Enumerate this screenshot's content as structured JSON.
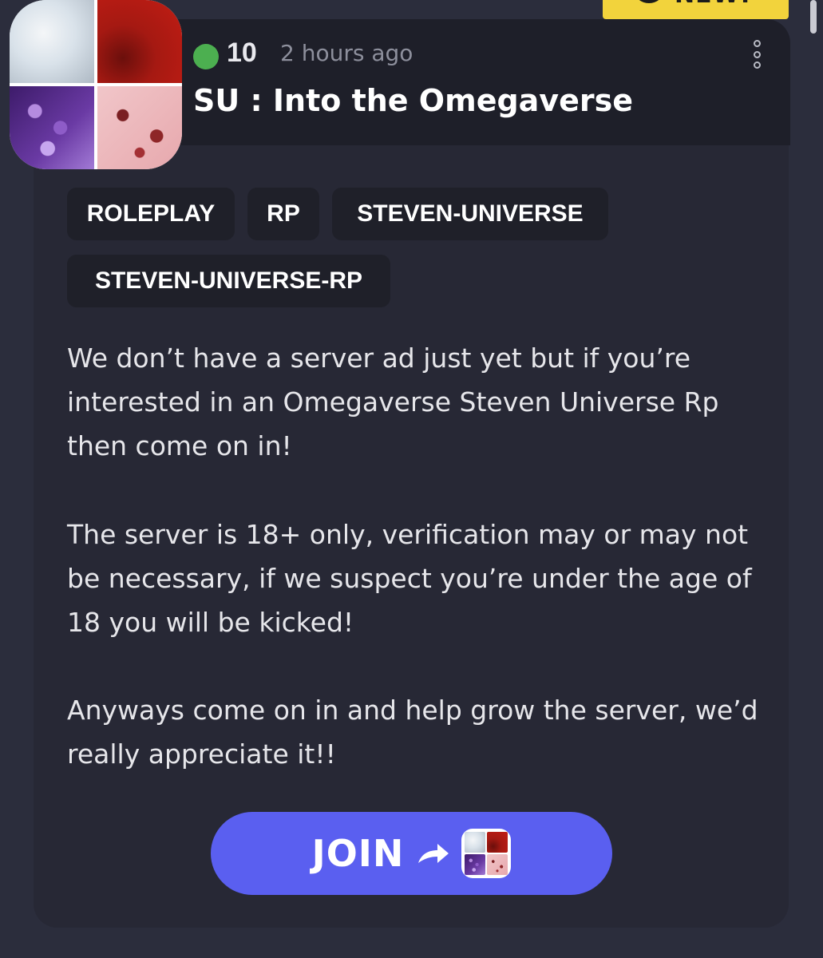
{
  "top_badge": {
    "label": "NEW!",
    "color": "#f2d33c"
  },
  "server": {
    "online_count": "10",
    "posted": "2 hours ago",
    "title": "SU : Into the Omegaverse",
    "online_indicator_color": "#4caf50",
    "avatar_icon": "server-avatar-collage"
  },
  "tags": [
    "ROLEPLAY",
    "RP",
    "STEVEN-UNIVERSE",
    "STEVEN-UNIVERSE-RP"
  ],
  "description": [
    "We don’t have a server ad just yet but if you’re interested in an Omegaverse Steven Universe Rp then come on in!",
    "The server is 18+ only, verification may or may not be necessary, if we suspect you’re under the age of 18 you will be kicked!",
    "Anyways come on in and help grow the server, we’d really appreciate it!!"
  ],
  "join_button": {
    "label": "JOIN",
    "color": "#5a5ff0"
  },
  "menu_icon": "more-vertical-icon"
}
